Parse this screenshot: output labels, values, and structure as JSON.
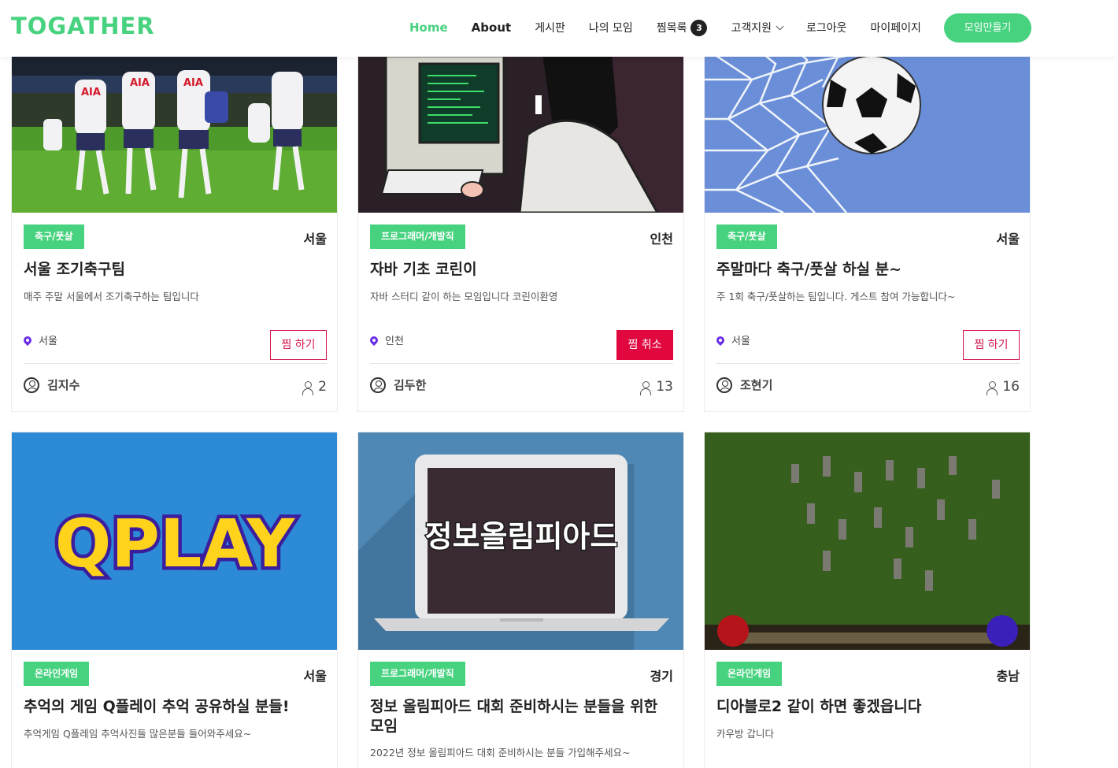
{
  "brand": {
    "name": "TOGATHER",
    "color": "#47d27f"
  },
  "nav": {
    "home": "Home",
    "about": "About",
    "board": "게시판",
    "my_groups": "나의 모임",
    "wishlist": "찜목록",
    "wishlist_count": "3",
    "support": "고객지원",
    "logout": "로그아웃",
    "mypage": "마이페이지",
    "create": "모임만들기"
  },
  "cards": [
    {
      "category": "축구/풋살",
      "region": "서울",
      "title": "서울 조기축구팀",
      "description": "매주 주말 서울에서 조기축구하는 팀입니다",
      "location": "서울",
      "wish_button": "찜 하기",
      "owner": "김지수",
      "members": "2",
      "image": "soccer-team-celebration"
    },
    {
      "category": "프로그래머/개발직",
      "region": "인천",
      "title": "자바 기초 코린이",
      "description": "자바 스터디 같이 하는 모임입니다 코린이환영",
      "location": "인천",
      "wish_button": "찜 취소",
      "owner": "김두한",
      "members": "13",
      "image": "programmer-retro-computer"
    },
    {
      "category": "축구/풋살",
      "region": "서울",
      "title": "주말마다 축구/풋살 하실 분~",
      "description": "주 1회 축구/풋살하는 팀입니다. 게스트 참여 가능합니다~",
      "location": "서울",
      "wish_button": "찜 하기",
      "owner": "조현기",
      "members": "16",
      "image": "soccer-ball-net"
    },
    {
      "category": "온라인게임",
      "region": "서울",
      "title": "추억의 게임 Q플레이 추억 공유하실 분들!",
      "description": "추억게임 Q플레임 추억사진들 많은분들 들어와주세요~",
      "image": "qplay-logo",
      "image_text": "QPLAY"
    },
    {
      "category": "프로그래머/개발직",
      "region": "경기",
      "title": "정보 올림피아드 대회 준비하시는 분들을 위한 모임",
      "description": "2022년 정보 올림피아드 대회 준비하시는 분들 가입해주세요~",
      "image": "laptop-olympiad",
      "image_text": "정보올림피아드"
    },
    {
      "category": "온라인게임",
      "region": "충남",
      "title": "디아블로2 같이 하면 좋겠읍니다",
      "description": "카우방 갑니다",
      "image": "diablo2-screenshot"
    }
  ]
}
